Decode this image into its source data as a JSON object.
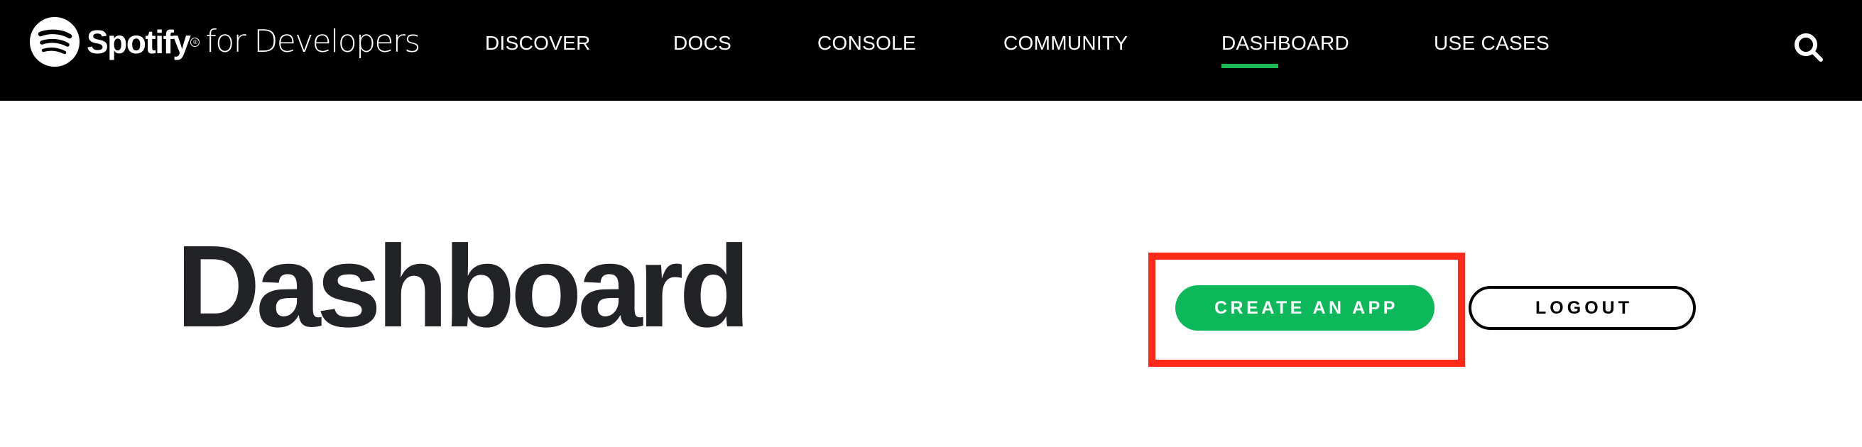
{
  "header": {
    "brand": {
      "name": "Spotify",
      "registered": "®",
      "suffix": "for Developers",
      "icon": "spotify-logo-icon"
    },
    "nav": [
      {
        "label": "DISCOVER",
        "active": false
      },
      {
        "label": "DOCS",
        "active": false
      },
      {
        "label": "CONSOLE",
        "active": false
      },
      {
        "label": "COMMUNITY",
        "active": false
      },
      {
        "label": "DASHBOARD",
        "active": true
      },
      {
        "label": "USE CASES",
        "active": false
      }
    ],
    "search_icon": "search-icon"
  },
  "main": {
    "title": "Dashboard",
    "create_app_label": "CREATE AN APP",
    "logout_label": "LOGOUT"
  },
  "colors": {
    "header_bg": "#000000",
    "accent_green": "#1db954",
    "button_green": "#0db85a",
    "title_text": "#222326",
    "highlight_red": "#ff2a1a"
  }
}
